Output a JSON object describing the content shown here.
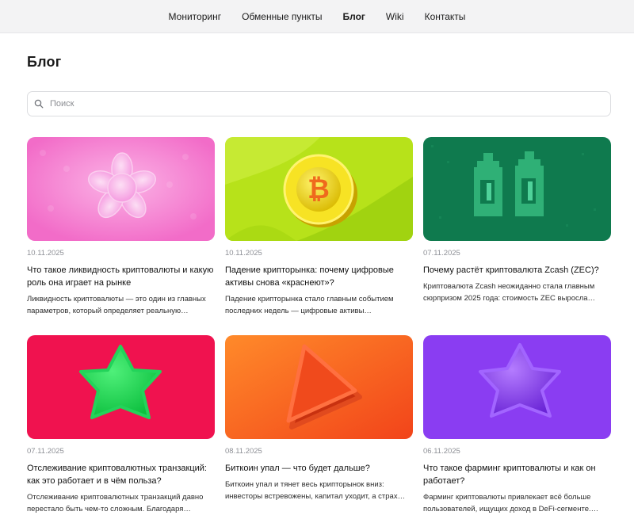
{
  "nav": {
    "items": [
      {
        "label": "Мониторинг",
        "active": false
      },
      {
        "label": "Обменные пункты",
        "active": false
      },
      {
        "label": "Блог",
        "active": true
      },
      {
        "label": "Wiki",
        "active": false
      },
      {
        "label": "Контакты",
        "active": false
      }
    ]
  },
  "page": {
    "title": "Блог"
  },
  "search": {
    "placeholder": "Поиск",
    "icon": "search-icon"
  },
  "posts": [
    {
      "date": "10.11.2025",
      "title": "Что такое ликвидность криптовалюты и какую роль она играет на рынке",
      "excerpt": "Ликвидность криптовалюты — это один из главных параметров, который определяет реальную…",
      "image": "pink-flower-shape",
      "bg": "#f57ccf"
    },
    {
      "date": "10.11.2025",
      "title": "Падение крипторынка: почему цифровые активы снова «краснеют»?",
      "excerpt": "Падение крипторынка стало главным событием последних недель — цифровые активы…",
      "image": "bitcoin-coin",
      "bg": "#b7e21a"
    },
    {
      "date": "07.11.2025",
      "title": "Почему растёт криптовалюта Zcash (ZEC)?",
      "excerpt": "Криптовалюта Zcash неожиданно стала главным сюрпризом 2025 года: стоимость ZEC выросла…",
      "image": "pixel-bottles",
      "bg": "#0f7a4e"
    },
    {
      "date": "07.11.2025",
      "title": "Отслеживание криптовалютных транзакций: как это работает и в чём польза?",
      "excerpt": "Отслеживание криптовалютных транзакций давно перестало быть чем-то сложным. Благодаря…",
      "image": "green-star",
      "bg": "#f0124f"
    },
    {
      "date": "08.11.2025",
      "title": "Биткоин упал — что будет дальше?",
      "excerpt": "Биткоин упал и тянет весь крипторынок вниз: инвесторы встревожены, капитал уходит, а страх…",
      "image": "red-play-triangle",
      "bg": "#f4561d"
    },
    {
      "date": "06.11.2025",
      "title": "Что такое фарминг криптовалюты и как он работает?",
      "excerpt": "Фарминг криптовалюты привлекает всё больше пользователей, ищущих доход в DeFi-сегменте.…",
      "image": "purple-star",
      "bg": "#8a3df2"
    }
  ]
}
